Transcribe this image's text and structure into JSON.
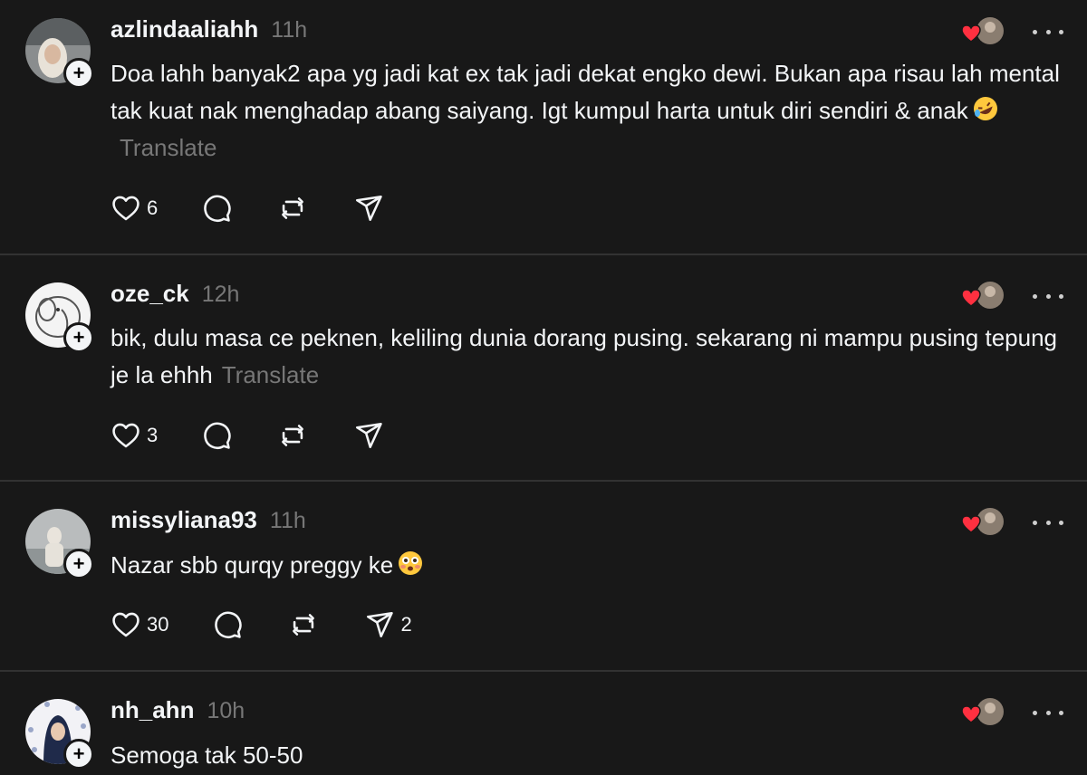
{
  "posts": [
    {
      "username": "azlindaaliahh",
      "time": "11h",
      "text": "Doa lahh banyak2 apa yg jadi kat ex tak jadi dekat engko dewi. Bukan apa risau lah mental tak kuat nak menghadap abang saiyang. Igt kumpul harta untuk diri sendiri & anak",
      "emoji": "rofl-emoji",
      "translate": "Translate",
      "likes": "6",
      "replies": "",
      "reposts": "",
      "shares": ""
    },
    {
      "username": "oze_ck",
      "time": "12h",
      "text": "bik, dulu masa ce peknen, keliling dunia dorang pusing. sekarang ni mampu pusing tepung je la ehhh",
      "emoji": "",
      "translate": "Translate",
      "likes": "3",
      "replies": "",
      "reposts": "",
      "shares": ""
    },
    {
      "username": "missyliana93",
      "time": "11h",
      "text": "Nazar sbb qurqy preggy ke",
      "emoji": "flushed-emoji",
      "translate": "",
      "likes": "30",
      "replies": "",
      "reposts": "",
      "shares": "2"
    },
    {
      "username": "nh_ahn",
      "time": "10h",
      "text": "Semoga tak 50-50",
      "emoji": "",
      "translate": "",
      "likes": "",
      "replies": "",
      "reposts": "",
      "shares": ""
    }
  ],
  "colors": {
    "background": "#181818",
    "text": "#f3f5f7",
    "muted": "#777777",
    "divider": "#323232",
    "heart": "#ff3040"
  },
  "icons": [
    "heart-icon",
    "comment-icon",
    "repost-icon",
    "share-icon",
    "more-icon",
    "plus-icon"
  ]
}
